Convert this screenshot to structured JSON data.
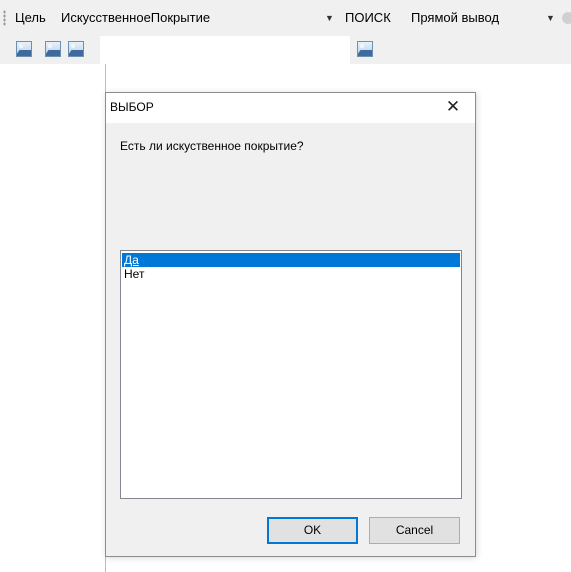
{
  "toolbar": {
    "goal_label": "Цель",
    "goal_value": "ИскусственноеПокрытие",
    "search_label": "ПОИСК",
    "search_value": "Прямой вывод"
  },
  "icons": {
    "dropdown": "chevron-down-icon",
    "image": "image-icon",
    "close": "close-icon"
  },
  "dialog": {
    "title": "ВЫБОР",
    "close_glyph": "✕",
    "question": "Есть ли искуственное покрытие?",
    "options": [
      "Да",
      "Нет"
    ],
    "selected_option": "Да",
    "ok_label": "OK",
    "cancel_label": "Cancel"
  },
  "colors": {
    "selection": "#0078d7",
    "dialog_bg": "#f0f0f0",
    "toolbar_bg": "#f0f0f0"
  }
}
